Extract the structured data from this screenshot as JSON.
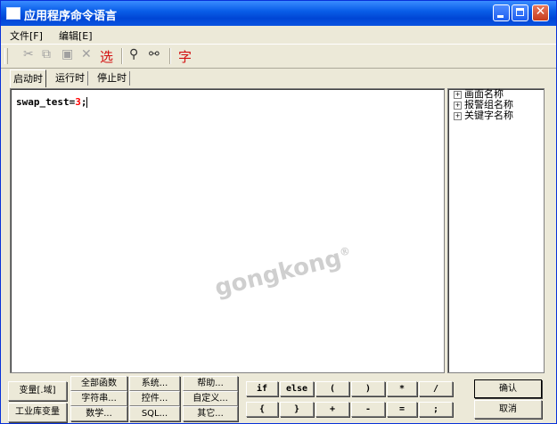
{
  "window": {
    "title": "应用程序命令语言"
  },
  "menu": [
    {
      "label": "文件[F]"
    },
    {
      "label": "编辑[E]"
    }
  ],
  "toolbar": {
    "select_label": "选",
    "font_label": "字"
  },
  "tabs": [
    {
      "label": "启动时",
      "active": true
    },
    {
      "label": "运行时"
    },
    {
      "label": "停止时"
    }
  ],
  "editor": {
    "code_prefix": "swap_test=",
    "code_number": "3",
    "code_suffix": ";"
  },
  "watermark": "gongkong",
  "tree": [
    {
      "toggle": "+",
      "label": "画面名称"
    },
    {
      "toggle": "+",
      "label": "报警组名称"
    },
    {
      "toggle": "+",
      "label": "关键字名称"
    }
  ],
  "buttons": {
    "variable": "变量[.域]",
    "industrial": "工业库变量",
    "all_functions": "全部函数",
    "system": "系统...",
    "help": "帮助...",
    "string": "字符串...",
    "control": "控件...",
    "custom": "自定义...",
    "math": "数学...",
    "sql": "SQL...",
    "other": "其它...",
    "op_if": "if",
    "op_else": "else",
    "op_lparen": "(",
    "op_rparen": ")",
    "op_mul": "*",
    "op_div": "/",
    "op_lbrace": "{",
    "op_rbrace": "}",
    "op_plus": "+",
    "op_minus": "-",
    "op_eq": "=",
    "op_semi": ";",
    "ok": "确认",
    "cancel": "取消"
  }
}
